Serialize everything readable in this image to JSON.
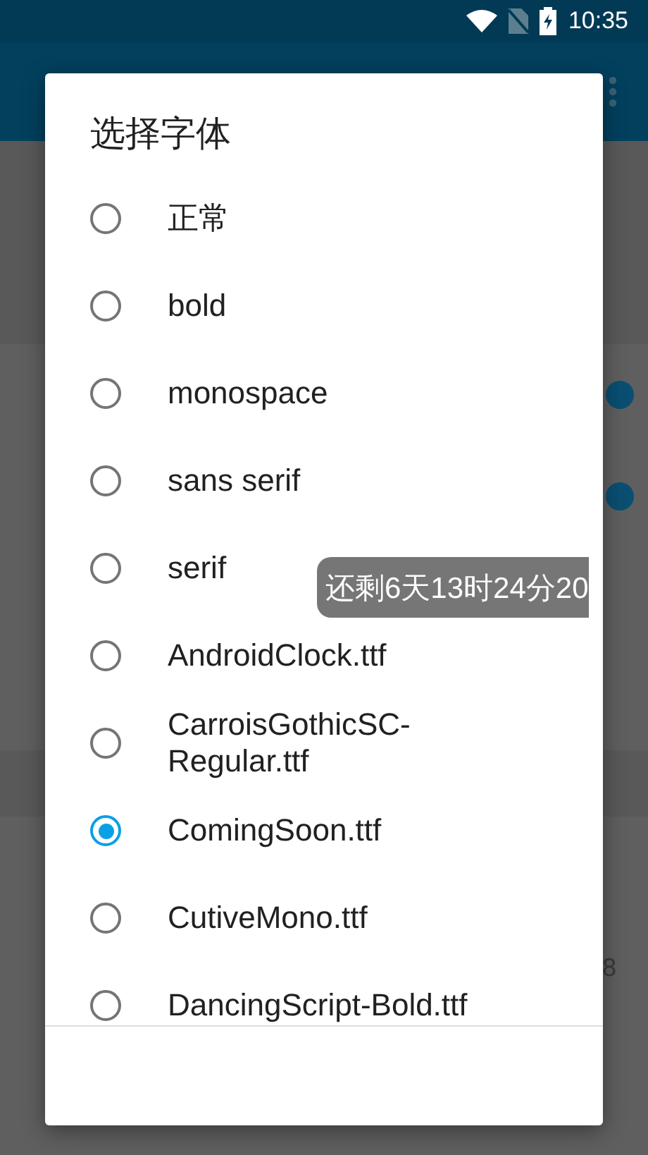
{
  "status_bar": {
    "time": "10:35"
  },
  "settings": [
    {
      "kind": "plain"
    },
    {
      "kind": "plain"
    },
    {
      "kind": "toggle",
      "on": true
    },
    {
      "kind": "toggle",
      "on": true
    },
    {
      "kind": "plain"
    },
    {
      "kind": "plain"
    },
    {
      "kind": "header"
    },
    {
      "kind": "plain"
    },
    {
      "kind": "text",
      "value": "8"
    },
    {
      "kind": "plain"
    },
    {
      "kind": "plain"
    }
  ],
  "dialog": {
    "title": "选择字体",
    "options": [
      {
        "label": "正常",
        "selected": false
      },
      {
        "label": "bold",
        "selected": false
      },
      {
        "label": "monospace",
        "selected": false
      },
      {
        "label": "sans serif",
        "selected": false
      },
      {
        "label": "serif",
        "selected": false
      },
      {
        "label": "AndroidClock.ttf",
        "selected": false
      },
      {
        "label": "CarroisGothicSC-Regular.ttf",
        "selected": false
      },
      {
        "label": "ComingSoon.ttf",
        "selected": true
      },
      {
        "label": "CutiveMono.ttf",
        "selected": false
      },
      {
        "label": "DancingScript-Bold.ttf",
        "selected": false
      }
    ]
  },
  "toast": {
    "text": "还剩6天13时24分20"
  }
}
